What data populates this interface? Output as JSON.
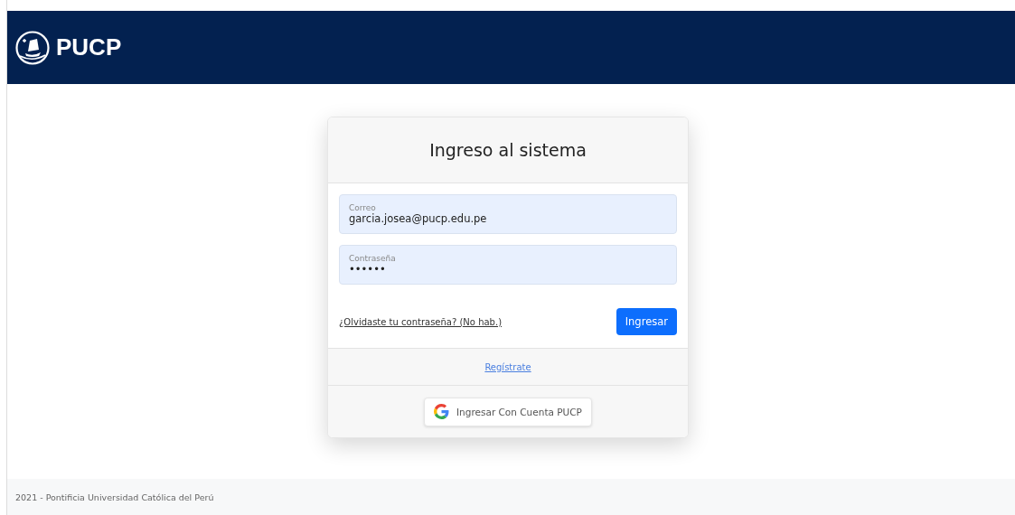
{
  "header": {
    "brand": "PUCP"
  },
  "login_card": {
    "title": "Ingreso al sistema",
    "fields": [
      {
        "label": "Correo",
        "value": "garcia.josea@pucp.edu.pe"
      },
      {
        "label": "Contraseña",
        "value": "••••••"
      }
    ],
    "forgot_link": "¿Olvidaste tu contraseña? (No hab.)",
    "submit_button": "Ingresar",
    "register_link": "Regístrate",
    "google_button": "Ingresar Con Cuenta PUCP"
  },
  "footer": {
    "text": "2021 - Pontificia Universidad Católica del Perú"
  }
}
